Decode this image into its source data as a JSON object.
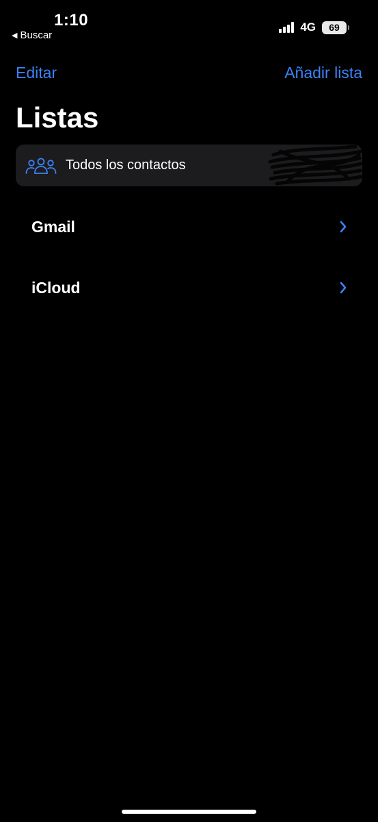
{
  "status_bar": {
    "time": "1:10",
    "back_label": "Buscar",
    "network": "4G",
    "battery_level": "69",
    "signal_bars": 4
  },
  "nav": {
    "edit_label": "Editar",
    "add_list_label": "Añadir lista"
  },
  "title": "Listas",
  "all_contacts": {
    "label": "Todos los contactos",
    "icon": "people-group-icon"
  },
  "lists": [
    {
      "label": "Gmail",
      "icon": "chevron-right-icon"
    },
    {
      "label": "iCloud",
      "icon": "chevron-right-icon"
    }
  ],
  "colors": {
    "background": "#000000",
    "accent": "#3b82f6",
    "cell_background": "#1c1c1e",
    "text": "#ffffff"
  }
}
